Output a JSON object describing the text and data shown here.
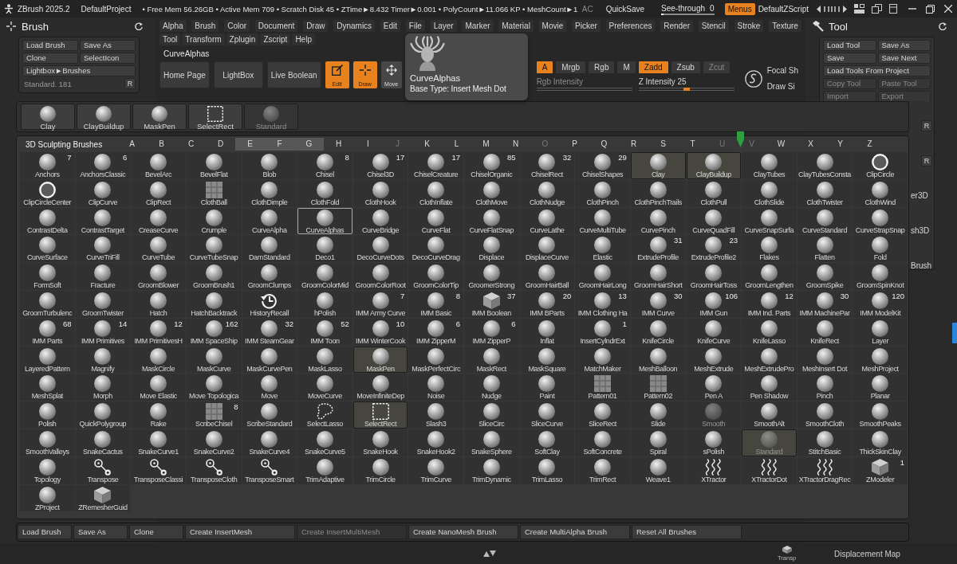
{
  "titlebar": {
    "app": "ZBrush 2025.2",
    "project": "DefaultProject",
    "stats": "• Free Mem 56.26GB • Active Mem 709 • Scratch Disk 45 • ZTime►8.432 Timer►0.001 • PolyCount►11.066 KP • MeshCount►1",
    "ac": "AC",
    "quicksave": "QuickSave",
    "see_through": {
      "label": "See-through",
      "value": "0",
      "level": 0
    },
    "menus": {
      "label": "Menus",
      "on": true
    },
    "script": "DefaultZScript"
  },
  "brush_panel": {
    "title": "Brush",
    "buttons": [
      {
        "label": "Load Brush",
        "kind": "half"
      },
      {
        "label": "Save As",
        "kind": "half"
      },
      {
        "label": "Clone",
        "kind": "half"
      },
      {
        "label": "SelectIcon",
        "kind": "half"
      },
      {
        "label": "Lightbox►Brushes",
        "kind": "wide"
      }
    ],
    "current": "Standard. 181",
    "reset": "R"
  },
  "menu_bar": {
    "menus": [
      "Alpha",
      "Brush",
      "Color",
      "Document",
      "Draw",
      "Dynamics",
      "Edit",
      "File",
      "Layer",
      "Marker",
      "Material",
      "Movie",
      "Picker",
      "Preferences",
      "Render",
      "Stencil",
      "Stroke",
      "Texture"
    ],
    "submenus": [
      "Tool",
      "Transform",
      "Zplugin",
      "Zscript",
      "Help"
    ]
  },
  "shelf": {
    "current_tool": "CurveAlphas",
    "buttons": [
      "Home Page",
      "LightBox",
      "Live Boolean"
    ],
    "modes": [
      {
        "label": "Edit",
        "on": true
      },
      {
        "label": "Draw",
        "on": true
      },
      {
        "label": "Move",
        "on": false
      }
    ],
    "channels": [
      {
        "label": "A",
        "on": true,
        "disabled": false
      },
      {
        "label": "Mrgb",
        "on": false,
        "disabled": false
      },
      {
        "label": "Rgb",
        "on": false,
        "disabled": false
      },
      {
        "label": "M",
        "on": false,
        "disabled": false
      },
      {
        "label": "Zadd",
        "on": true,
        "disabled": false
      },
      {
        "label": "Zsub",
        "on": false,
        "disabled": false
      },
      {
        "label": "Zcut",
        "on": false,
        "disabled": true
      }
    ],
    "sliders": [
      {
        "label": "Rgb Intensity",
        "disabled": true
      },
      {
        "label": "Z Intensity 25",
        "disabled": false,
        "level": 0.5
      }
    ],
    "focal_shift": "Focal Sh",
    "draw_size": "Draw Si"
  },
  "tool_panel": {
    "title": "Tool",
    "buttons": [
      {
        "label": "Load Tool",
        "kind": "half",
        "disabled": false
      },
      {
        "label": "Save As",
        "kind": "half",
        "disabled": false
      },
      {
        "label": "Save",
        "kind": "half",
        "disabled": false
      },
      {
        "label": "Save Next",
        "kind": "half",
        "disabled": false
      },
      {
        "label": "Load Tools From Project",
        "kind": "wide",
        "disabled": false
      },
      {
        "label": "Copy Tool",
        "kind": "half",
        "disabled": true
      },
      {
        "label": "Paste Tool",
        "kind": "half",
        "disabled": true
      },
      {
        "label": "Import",
        "kind": "half",
        "disabled": true
      },
      {
        "label": "Export",
        "kind": "half",
        "disabled": true
      }
    ],
    "fragments": [
      {
        "text": "R",
        "kind": "button"
      },
      {
        "text": "R",
        "kind": "button"
      },
      {
        "text": "er3D",
        "kind": "label"
      },
      {
        "text": "sh3D",
        "kind": "label"
      },
      {
        "text": "Brush",
        "kind": "label"
      }
    ]
  },
  "tooltip": {
    "title": "CurveAlphas",
    "detail": "Base Type: Insert Mesh Dot"
  },
  "brush_popup": {
    "recent": [
      {
        "name": "Clay",
        "disabled": false
      },
      {
        "name": "ClayBuildup",
        "disabled": false
      },
      {
        "name": "MaskPen",
        "disabled": false
      },
      {
        "name": "SelectRect",
        "disabled": false
      },
      {
        "name": "Standard",
        "disabled": true
      }
    ],
    "palette": {
      "title": "3D Sculpting Brushes",
      "letters": [
        {
          "letter": "A",
          "dimmed": false,
          "highlighted": false,
          "marked": false
        },
        {
          "letter": "B",
          "dimmed": false,
          "highlighted": false,
          "marked": false
        },
        {
          "letter": "C",
          "dimmed": false,
          "highlighted": false,
          "marked": false
        },
        {
          "letter": "D",
          "dimmed": false,
          "highlighted": false,
          "marked": false
        },
        {
          "letter": "E",
          "dimmed": false,
          "highlighted": true,
          "marked": false
        },
        {
          "letter": "F",
          "dimmed": false,
          "highlighted": true,
          "marked": false
        },
        {
          "letter": "G",
          "dimmed": false,
          "highlighted": true,
          "marked": false
        },
        {
          "letter": "H",
          "dimmed": false,
          "highlighted": false,
          "marked": false
        },
        {
          "letter": "I",
          "dimmed": false,
          "highlighted": false,
          "marked": false
        },
        {
          "letter": "J",
          "dimmed": true,
          "highlighted": false,
          "marked": false
        },
        {
          "letter": "K",
          "dimmed": false,
          "highlighted": false,
          "marked": false
        },
        {
          "letter": "L",
          "dimmed": false,
          "highlighted": false,
          "marked": false
        },
        {
          "letter": "M",
          "dimmed": false,
          "highlighted": false,
          "marked": false
        },
        {
          "letter": "N",
          "dimmed": false,
          "highlighted": false,
          "marked": false
        },
        {
          "letter": "O",
          "dimmed": true,
          "highlighted": false,
          "marked": false
        },
        {
          "letter": "P",
          "dimmed": false,
          "highlighted": false,
          "marked": false
        },
        {
          "letter": "Q",
          "dimmed": false,
          "highlighted": false,
          "marked": false
        },
        {
          "letter": "R",
          "dimmed": false,
          "highlighted": false,
          "marked": false
        },
        {
          "letter": "S",
          "dimmed": false,
          "highlighted": false,
          "marked": false
        },
        {
          "letter": "T",
          "dimmed": false,
          "highlighted": false,
          "marked": false
        },
        {
          "letter": "U",
          "dimmed": true,
          "highlighted": false,
          "marked": false
        },
        {
          "letter": "V",
          "dimmed": true,
          "highlighted": false,
          "marked": true
        },
        {
          "letter": "W",
          "dimmed": false,
          "highlighted": false,
          "marked": false
        },
        {
          "letter": "X",
          "dimmed": false,
          "highlighted": false,
          "marked": false
        },
        {
          "letter": "Y",
          "dimmed": false,
          "highlighted": false,
          "marked": false
        },
        {
          "letter": "Z",
          "dimmed": false,
          "highlighted": false,
          "marked": false
        }
      ],
      "brushes": [
        {
          "name": "Anchors",
          "count": "7",
          "selected": false,
          "highlighted": false,
          "disabled": false
        },
        {
          "name": "AnchorsClassic",
          "count": "6",
          "selected": false,
          "highlighted": false,
          "disabled": false
        },
        {
          "name": "BevelArc",
          "selected": false,
          "highlighted": false,
          "disabled": false
        },
        {
          "name": "BevelFlat",
          "selected": false,
          "highlighted": false,
          "disabled": false
        },
        {
          "name": "Blob",
          "selected": false,
          "highlighted": false,
          "disabled": false
        },
        {
          "name": "Chisel",
          "count": "8",
          "selected": false,
          "highlighted": false,
          "disabled": false
        },
        {
          "name": "Chisel3D",
          "count": "17",
          "selected": false,
          "highlighted": false,
          "disabled": false
        },
        {
          "name": "ChiselCreature",
          "count": "17",
          "selected": false,
          "highlighted": false,
          "disabled": false
        },
        {
          "name": "ChiselOrganic",
          "count": "85",
          "selected": false,
          "highlighted": false,
          "disabled": false
        },
        {
          "name": "ChiselRect",
          "count": "32",
          "selected": false,
          "highlighted": false,
          "disabled": false
        },
        {
          "name": "ChiselShapes",
          "count": "29",
          "selected": false,
          "highlighted": false,
          "disabled": false
        },
        {
          "name": "Clay",
          "selected": false,
          "highlighted": true,
          "disabled": false
        },
        {
          "name": "ClayBuildup",
          "selected": false,
          "highlighted": true,
          "disabled": false
        },
        {
          "name": "ClayTubes",
          "selected": false,
          "highlighted": false,
          "disabled": false
        },
        {
          "name": "ClayTubesConsta",
          "selected": false,
          "highlighted": false,
          "disabled": false
        },
        {
          "name": "ClipCircle",
          "selected": false,
          "highlighted": false,
          "disabled": false
        },
        {
          "name": "ClipCircleCenter",
          "selected": false,
          "highlighted": false,
          "disabled": false
        },
        {
          "name": "ClipCurve",
          "selected": false,
          "highlighted": false,
          "disabled": false
        },
        {
          "name": "ClipRect",
          "selected": false,
          "highlighted": false,
          "disabled": false
        },
        {
          "name": "ClothBall",
          "selected": false,
          "highlighted": false,
          "disabled": false
        },
        {
          "name": "ClothDimple",
          "selected": false,
          "highlighted": false,
          "disabled": false
        },
        {
          "name": "ClothFold",
          "selected": false,
          "highlighted": false,
          "disabled": false
        },
        {
          "name": "ClothHook",
          "selected": false,
          "highlighted": false,
          "disabled": false
        },
        {
          "name": "ClothInflate",
          "selected": false,
          "highlighted": false,
          "disabled": false
        },
        {
          "name": "ClothMove",
          "selected": false,
          "highlighted": false,
          "disabled": false
        },
        {
          "name": "ClothNudge",
          "selected": false,
          "highlighted": false,
          "disabled": false
        },
        {
          "name": "ClothPinch",
          "selected": false,
          "highlighted": false,
          "disabled": false
        },
        {
          "name": "ClothPinchTrails",
          "selected": false,
          "highlighted": false,
          "disabled": false
        },
        {
          "name": "ClothPull",
          "selected": false,
          "highlighted": false,
          "disabled": false
        },
        {
          "name": "ClothSlide",
          "selected": false,
          "highlighted": false,
          "disabled": false
        },
        {
          "name": "ClothTwister",
          "selected": false,
          "highlighted": false,
          "disabled": false
        },
        {
          "name": "ClothWind",
          "selected": false,
          "highlighted": false,
          "disabled": false
        },
        {
          "name": "ContrastDelta",
          "selected": false,
          "highlighted": false,
          "disabled": false
        },
        {
          "name": "ContrastTarget",
          "selected": false,
          "highlighted": false,
          "disabled": false
        },
        {
          "name": "CreaseCurve",
          "selected": false,
          "highlighted": false,
          "disabled": false
        },
        {
          "name": "Crumple",
          "selected": false,
          "highlighted": false,
          "disabled": false
        },
        {
          "name": "CurveAlpha",
          "selected": false,
          "highlighted": false,
          "disabled": false
        },
        {
          "name": "CurveAlphas",
          "selected": true,
          "highlighted": false,
          "disabled": false
        },
        {
          "name": "CurveBridge",
          "selected": false,
          "highlighted": false,
          "disabled": false
        },
        {
          "name": "CurveFlat",
          "selected": false,
          "highlighted": false,
          "disabled": false
        },
        {
          "name": "CurveFlatSnap",
          "selected": false,
          "highlighted": false,
          "disabled": false
        },
        {
          "name": "CurveLathe",
          "selected": false,
          "highlighted": false,
          "disabled": false
        },
        {
          "name": "CurveMultiTube",
          "selected": false,
          "highlighted": false,
          "disabled": false
        },
        {
          "name": "CurvePinch",
          "selected": false,
          "highlighted": false,
          "disabled": false
        },
        {
          "name": "CurveQuadFill",
          "selected": false,
          "highlighted": false,
          "disabled": false
        },
        {
          "name": "CurveSnapSurfa",
          "selected": false,
          "highlighted": false,
          "disabled": false
        },
        {
          "name": "CurveStandard",
          "selected": false,
          "highlighted": false,
          "disabled": false
        },
        {
          "name": "CurveStrapSnap",
          "selected": false,
          "highlighted": false,
          "disabled": false
        },
        {
          "name": "CurveSurface",
          "selected": false,
          "highlighted": false,
          "disabled": false
        },
        {
          "name": "CurveTriFill",
          "selected": false,
          "highlighted": false,
          "disabled": false
        },
        {
          "name": "CurveTube",
          "selected": false,
          "highlighted": false,
          "disabled": false
        },
        {
          "name": "CurveTubeSnap",
          "selected": false,
          "highlighted": false,
          "disabled": false
        },
        {
          "name": "DamStandard",
          "selected": false,
          "highlighted": false,
          "disabled": false
        },
        {
          "name": "Deco1",
          "selected": false,
          "highlighted": false,
          "disabled": false
        },
        {
          "name": "DecoCurveDots",
          "selected": false,
          "highlighted": false,
          "disabled": false
        },
        {
          "name": "DecoCurveDrag",
          "selected": false,
          "highlighted": false,
          "disabled": false
        },
        {
          "name": "Displace",
          "selected": false,
          "highlighted": false,
          "disabled": false
        },
        {
          "name": "DisplaceCurve",
          "selected": false,
          "highlighted": false,
          "disabled": false
        },
        {
          "name": "Elastic",
          "selected": false,
          "highlighted": false,
          "disabled": false
        },
        {
          "name": "ExtrudeProfile",
          "count": "31",
          "selected": false,
          "highlighted": false,
          "disabled": false
        },
        {
          "name": "ExtrudeProfile2",
          "count": "23",
          "selected": false,
          "highlighted": false,
          "disabled": false
        },
        {
          "name": "Flakes",
          "selected": false,
          "highlighted": false,
          "disabled": false
        },
        {
          "name": "Flatten",
          "selected": false,
          "highlighted": false,
          "disabled": false
        },
        {
          "name": "Fold",
          "selected": false,
          "highlighted": false,
          "disabled": false
        },
        {
          "name": "FormSoft",
          "selected": false,
          "highlighted": false,
          "disabled": false
        },
        {
          "name": "Fracture",
          "selected": false,
          "highlighted": false,
          "disabled": false
        },
        {
          "name": "GroomBlower",
          "selected": false,
          "highlighted": false,
          "disabled": false
        },
        {
          "name": "GroomBrush1",
          "selected": false,
          "highlighted": false,
          "disabled": false
        },
        {
          "name": "GroomClumps",
          "selected": false,
          "highlighted": false,
          "disabled": false
        },
        {
          "name": "GroomColorMid",
          "selected": false,
          "highlighted": false,
          "disabled": false
        },
        {
          "name": "GroomColorRoot",
          "selected": false,
          "highlighted": false,
          "disabled": false
        },
        {
          "name": "GroomColorTip",
          "selected": false,
          "highlighted": false,
          "disabled": false
        },
        {
          "name": "GroomerStrong",
          "selected": false,
          "highlighted": false,
          "disabled": false
        },
        {
          "name": "GroomHairBall",
          "selected": false,
          "highlighted": false,
          "disabled": false
        },
        {
          "name": "GroomHairLong",
          "selected": false,
          "highlighted": false,
          "disabled": false
        },
        {
          "name": "GroomHairShort",
          "selected": false,
          "highlighted": false,
          "disabled": false
        },
        {
          "name": "GroomHairToss",
          "selected": false,
          "highlighted": false,
          "disabled": false
        },
        {
          "name": "GroomLengthen",
          "selected": false,
          "highlighted": false,
          "disabled": false
        },
        {
          "name": "GroomSpike",
          "selected": false,
          "highlighted": false,
          "disabled": false
        },
        {
          "name": "GroomSpinKnot",
          "selected": false,
          "highlighted": false,
          "disabled": false
        },
        {
          "name": "GroomTurbulenc",
          "selected": false,
          "highlighted": false,
          "disabled": false
        },
        {
          "name": "GroomTwister",
          "selected": false,
          "highlighted": false,
          "disabled": false
        },
        {
          "name": "Hatch",
          "selected": false,
          "highlighted": false,
          "disabled": false
        },
        {
          "name": "HatchBacktrack",
          "selected": false,
          "highlighted": false,
          "disabled": false
        },
        {
          "name": "HistoryRecall",
          "selected": false,
          "highlighted": false,
          "disabled": false
        },
        {
          "name": "hPolish",
          "selected": false,
          "highlighted": false,
          "disabled": false
        },
        {
          "name": "IMM Army Curve",
          "count": "7",
          "selected": false,
          "highlighted": false,
          "disabled": false
        },
        {
          "name": "IMM Basic",
          "count": "8",
          "selected": false,
          "highlighted": false,
          "disabled": false
        },
        {
          "name": "IMM Boolean",
          "count": "37",
          "selected": false,
          "highlighted": false,
          "disabled": false
        },
        {
          "name": "IMM BParts",
          "count": "20",
          "selected": false,
          "highlighted": false,
          "disabled": false
        },
        {
          "name": "IMM Clothing Ha",
          "count": "13",
          "selected": false,
          "highlighted": false,
          "disabled": false
        },
        {
          "name": "IMM Curve",
          "count": "30",
          "selected": false,
          "highlighted": false,
          "disabled": false
        },
        {
          "name": "IMM Gun",
          "count": "106",
          "selected": false,
          "highlighted": false,
          "disabled": false
        },
        {
          "name": "IMM Ind. Parts",
          "count": "12",
          "selected": false,
          "highlighted": false,
          "disabled": false
        },
        {
          "name": "IMM MachinePar",
          "count": "30",
          "selected": false,
          "highlighted": false,
          "disabled": false
        },
        {
          "name": "IMM ModelKit",
          "count": "120",
          "selected": false,
          "highlighted": false,
          "disabled": false
        },
        {
          "name": "IMM Parts",
          "count": "68",
          "selected": false,
          "highlighted": false,
          "disabled": false
        },
        {
          "name": "IMM Primitives",
          "count": "14",
          "selected": false,
          "highlighted": false,
          "disabled": false
        },
        {
          "name": "IMM PrimitivesH",
          "count": "12",
          "selected": false,
          "highlighted": false,
          "disabled": false
        },
        {
          "name": "IMM SpaceShip",
          "count": "162",
          "selected": false,
          "highlighted": false,
          "disabled": false
        },
        {
          "name": "IMM SteamGear",
          "count": "32",
          "selected": false,
          "highlighted": false,
          "disabled": false
        },
        {
          "name": "IMM Toon",
          "count": "52",
          "selected": false,
          "highlighted": false,
          "disabled": false
        },
        {
          "name": "IMM WinterCook",
          "count": "10",
          "selected": false,
          "highlighted": false,
          "disabled": false
        },
        {
          "name": "IMM ZipperM",
          "count": "6",
          "selected": false,
          "highlighted": false,
          "disabled": false
        },
        {
          "name": "IMM ZipperP",
          "count": "6",
          "selected": false,
          "highlighted": false,
          "disabled": false
        },
        {
          "name": "Inflat",
          "selected": false,
          "highlighted": false,
          "disabled": false
        },
        {
          "name": "InsertCylndrExt",
          "count": "1",
          "selected": false,
          "highlighted": false,
          "disabled": false
        },
        {
          "name": "KnifeCircle",
          "selected": false,
          "highlighted": false,
          "disabled": false
        },
        {
          "name": "KnifeCurve",
          "selected": false,
          "highlighted": false,
          "disabled": false
        },
        {
          "name": "KnifeLasso",
          "selected": false,
          "highlighted": false,
          "disabled": false
        },
        {
          "name": "KnifeRect",
          "selected": false,
          "highlighted": false,
          "disabled": false
        },
        {
          "name": "Layer",
          "selected": false,
          "highlighted": false,
          "disabled": false
        },
        {
          "name": "LayeredPattern",
          "selected": false,
          "highlighted": false,
          "disabled": false
        },
        {
          "name": "Magnify",
          "selected": false,
          "highlighted": false,
          "disabled": false
        },
        {
          "name": "MaskCircle",
          "selected": false,
          "highlighted": false,
          "disabled": false
        },
        {
          "name": "MaskCurve",
          "selected": false,
          "highlighted": false,
          "disabled": false
        },
        {
          "name": "MaskCurvePen",
          "selected": false,
          "highlighted": false,
          "disabled": false
        },
        {
          "name": "MaskLasso",
          "selected": false,
          "highlighted": false,
          "disabled": false
        },
        {
          "name": "MaskPen",
          "selected": false,
          "highlighted": true,
          "disabled": false
        },
        {
          "name": "MaskPerfectCirc",
          "selected": false,
          "highlighted": false,
          "disabled": false
        },
        {
          "name": "MaskRect",
          "selected": false,
          "highlighted": false,
          "disabled": false
        },
        {
          "name": "MaskSquare",
          "selected": false,
          "highlighted": false,
          "disabled": false
        },
        {
          "name": "MatchMaker",
          "selected": false,
          "highlighted": false,
          "disabled": false
        },
        {
          "name": "MeshBalloon",
          "selected": false,
          "highlighted": false,
          "disabled": false
        },
        {
          "name": "MeshExtrude",
          "selected": false,
          "highlighted": false,
          "disabled": false
        },
        {
          "name": "MeshExtrudePro",
          "selected": false,
          "highlighted": false,
          "disabled": false
        },
        {
          "name": "MeshInsert Dot",
          "selected": false,
          "highlighted": false,
          "disabled": false
        },
        {
          "name": "MeshProject",
          "selected": false,
          "highlighted": false,
          "disabled": false
        },
        {
          "name": "MeshSplat",
          "selected": false,
          "highlighted": false,
          "disabled": false
        },
        {
          "name": "Morph",
          "selected": false,
          "highlighted": false,
          "disabled": false
        },
        {
          "name": "Move Elastic",
          "selected": false,
          "highlighted": false,
          "disabled": false
        },
        {
          "name": "Move Topologica",
          "selected": false,
          "highlighted": false,
          "disabled": false
        },
        {
          "name": "Move",
          "selected": false,
          "highlighted": false,
          "disabled": false
        },
        {
          "name": "MoveCurve",
          "selected": false,
          "highlighted": false,
          "disabled": false
        },
        {
          "name": "MoveInfiniteDep",
          "selected": false,
          "highlighted": false,
          "disabled": false
        },
        {
          "name": "Noise",
          "selected": false,
          "highlighted": false,
          "disabled": false
        },
        {
          "name": "Nudge",
          "selected": false,
          "highlighted": false,
          "disabled": false
        },
        {
          "name": "Paint",
          "selected": false,
          "highlighted": false,
          "disabled": false
        },
        {
          "name": "Pattern01",
          "selected": false,
          "highlighted": false,
          "disabled": false
        },
        {
          "name": "Pattern02",
          "selected": false,
          "highlighted": false,
          "disabled": false
        },
        {
          "name": "Pen A",
          "selected": false,
          "highlighted": false,
          "disabled": false
        },
        {
          "name": "Pen Shadow",
          "selected": false,
          "highlighted": false,
          "disabled": false
        },
        {
          "name": "Pinch",
          "selected": false,
          "highlighted": false,
          "disabled": false
        },
        {
          "name": "Planar",
          "selected": false,
          "highlighted": false,
          "disabled": false
        },
        {
          "name": "Polish",
          "selected": false,
          "highlighted": false,
          "disabled": false
        },
        {
          "name": "QuickPolygroup",
          "selected": false,
          "highlighted": false,
          "disabled": false
        },
        {
          "name": "Rake",
          "selected": false,
          "highlighted": false,
          "disabled": false
        },
        {
          "name": "ScribeChisel",
          "count": "8",
          "selected": false,
          "highlighted": false,
          "disabled": false
        },
        {
          "name": "ScribeStandard",
          "selected": false,
          "highlighted": false,
          "disabled": false
        },
        {
          "name": "SelectLasso",
          "selected": false,
          "highlighted": false,
          "disabled": false
        },
        {
          "name": "SelectRect",
          "selected": false,
          "highlighted": true,
          "disabled": false
        },
        {
          "name": "Slash3",
          "selected": false,
          "highlighted": false,
          "disabled": false
        },
        {
          "name": "SliceCirc",
          "selected": false,
          "highlighted": false,
          "disabled": false
        },
        {
          "name": "SliceCurve",
          "selected": false,
          "highlighted": false,
          "disabled": false
        },
        {
          "name": "SliceRect",
          "selected": false,
          "highlighted": false,
          "disabled": false
        },
        {
          "name": "Slide",
          "selected": false,
          "highlighted": false,
          "disabled": false
        },
        {
          "name": "Smooth",
          "selected": false,
          "highlighted": false,
          "disabled": true
        },
        {
          "name": "SmoothAlt",
          "selected": false,
          "highlighted": false,
          "disabled": false
        },
        {
          "name": "SmoothCloth",
          "selected": false,
          "highlighted": false,
          "disabled": false
        },
        {
          "name": "SmoothPeaks",
          "selected": false,
          "highlighted": false,
          "disabled": false
        },
        {
          "name": "SmoothValleys",
          "selected": false,
          "highlighted": false,
          "disabled": false
        },
        {
          "name": "SnakeCactus",
          "selected": false,
          "highlighted": false,
          "disabled": false
        },
        {
          "name": "SnakeCurve1",
          "selected": false,
          "highlighted": false,
          "disabled": false
        },
        {
          "name": "SnakeCurve2",
          "selected": false,
          "highlighted": false,
          "disabled": false
        },
        {
          "name": "SnakeCurve4",
          "selected": false,
          "highlighted": false,
          "disabled": false
        },
        {
          "name": "SnakeCurve5",
          "selected": false,
          "highlighted": false,
          "disabled": false
        },
        {
          "name": "SnakeHook",
          "selected": false,
          "highlighted": false,
          "disabled": false
        },
        {
          "name": "SnakeHook2",
          "selected": false,
          "highlighted": false,
          "disabled": false
        },
        {
          "name": "SnakeSphere",
          "selected": false,
          "highlighted": false,
          "disabled": false
        },
        {
          "name": "SoftClay",
          "selected": false,
          "highlighted": false,
          "disabled": false
        },
        {
          "name": "SoftConcrete",
          "selected": false,
          "highlighted": false,
          "disabled": false
        },
        {
          "name": "Spiral",
          "selected": false,
          "highlighted": false,
          "disabled": false
        },
        {
          "name": "sPolish",
          "selected": false,
          "highlighted": false,
          "disabled": false
        },
        {
          "name": "Standard",
          "selected": false,
          "highlighted": true,
          "disabled": true
        },
        {
          "name": "StitchBasic",
          "selected": false,
          "highlighted": false,
          "disabled": false
        },
        {
          "name": "ThickSkinClay",
          "selected": false,
          "highlighted": false,
          "disabled": false
        },
        {
          "name": "Topology",
          "selected": false,
          "highlighted": false,
          "disabled": false
        },
        {
          "name": "Transpose",
          "selected": false,
          "highlighted": false,
          "disabled": false
        },
        {
          "name": "TransposeClassi",
          "selected": false,
          "highlighted": false,
          "disabled": false
        },
        {
          "name": "TransposeCloth",
          "selected": false,
          "highlighted": false,
          "disabled": false
        },
        {
          "name": "TransposeSmart",
          "selected": false,
          "highlighted": false,
          "disabled": false
        },
        {
          "name": "TrimAdaptive",
          "selected": false,
          "highlighted": false,
          "disabled": false
        },
        {
          "name": "TrimCircle",
          "selected": false,
          "highlighted": false,
          "disabled": false
        },
        {
          "name": "TrimCurve",
          "selected": false,
          "highlighted": false,
          "disabled": false
        },
        {
          "name": "TrimDynamic",
          "selected": false,
          "highlighted": false,
          "disabled": false
        },
        {
          "name": "TrimLasso",
          "selected": false,
          "highlighted": false,
          "disabled": false
        },
        {
          "name": "TrimRect",
          "selected": false,
          "highlighted": false,
          "disabled": false
        },
        {
          "name": "Weave1",
          "selected": false,
          "highlighted": false,
          "disabled": false
        },
        {
          "name": "XTractor",
          "selected": false,
          "highlighted": false,
          "disabled": false
        },
        {
          "name": "XTractorDot",
          "selected": false,
          "highlighted": false,
          "disabled": false
        },
        {
          "name": "XTractorDragRec",
          "selected": false,
          "highlighted": false,
          "disabled": false
        },
        {
          "name": "ZModeler",
          "count": "1",
          "selected": false,
          "highlighted": false,
          "disabled": false
        },
        {
          "name": "ZProject",
          "selected": false,
          "highlighted": false,
          "disabled": false
        },
        {
          "name": "ZRemesherGuid",
          "selected": false,
          "highlighted": false,
          "disabled": false
        }
      ]
    },
    "actions": [
      {
        "label": "Load Brush",
        "kind": "small",
        "disabled": false
      },
      {
        "label": "Save As",
        "kind": "small",
        "disabled": false
      },
      {
        "label": "Clone",
        "kind": "small",
        "disabled": false
      },
      {
        "label": "Create InsertMesh",
        "kind": "large",
        "disabled": false
      },
      {
        "label": "Create InsertMultiMesh",
        "kind": "large",
        "disabled": true
      },
      {
        "label": "Create NanoMesh Brush",
        "kind": "large",
        "disabled": false
      },
      {
        "label": "Create MultiAlpha Brush",
        "kind": "large",
        "disabled": false
      },
      {
        "label": "Reset All Brushes",
        "kind": "large",
        "disabled": false
      }
    ]
  },
  "bottom_bar": {
    "transp": "Transp",
    "displacement": "Displacement Map"
  }
}
